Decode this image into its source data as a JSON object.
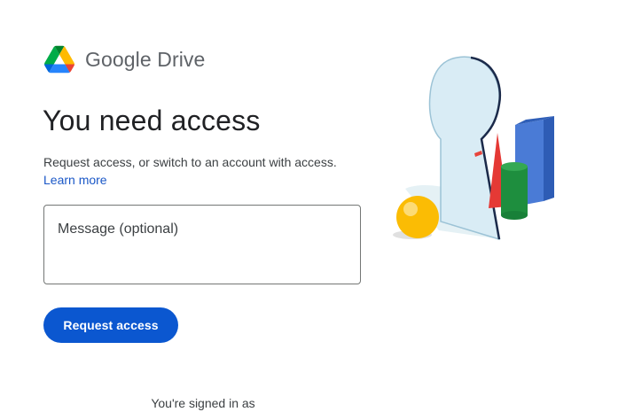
{
  "brand": {
    "logo_icon": "google-drive-logo",
    "name": "Google Drive"
  },
  "main": {
    "title": "You need access",
    "subtitle": "Request access, or switch to an account with access.",
    "learn_more": "Learn more",
    "message_placeholder": "Message (optional)",
    "request_button": "Request access",
    "signed_in_text": "You're signed in as"
  },
  "illustration": {
    "icon": "keyhole-access-illustration"
  },
  "colors": {
    "accent": "#0b57d0",
    "link": "#1a57c7",
    "title_text": "#202124",
    "body_text": "#3c4043"
  }
}
